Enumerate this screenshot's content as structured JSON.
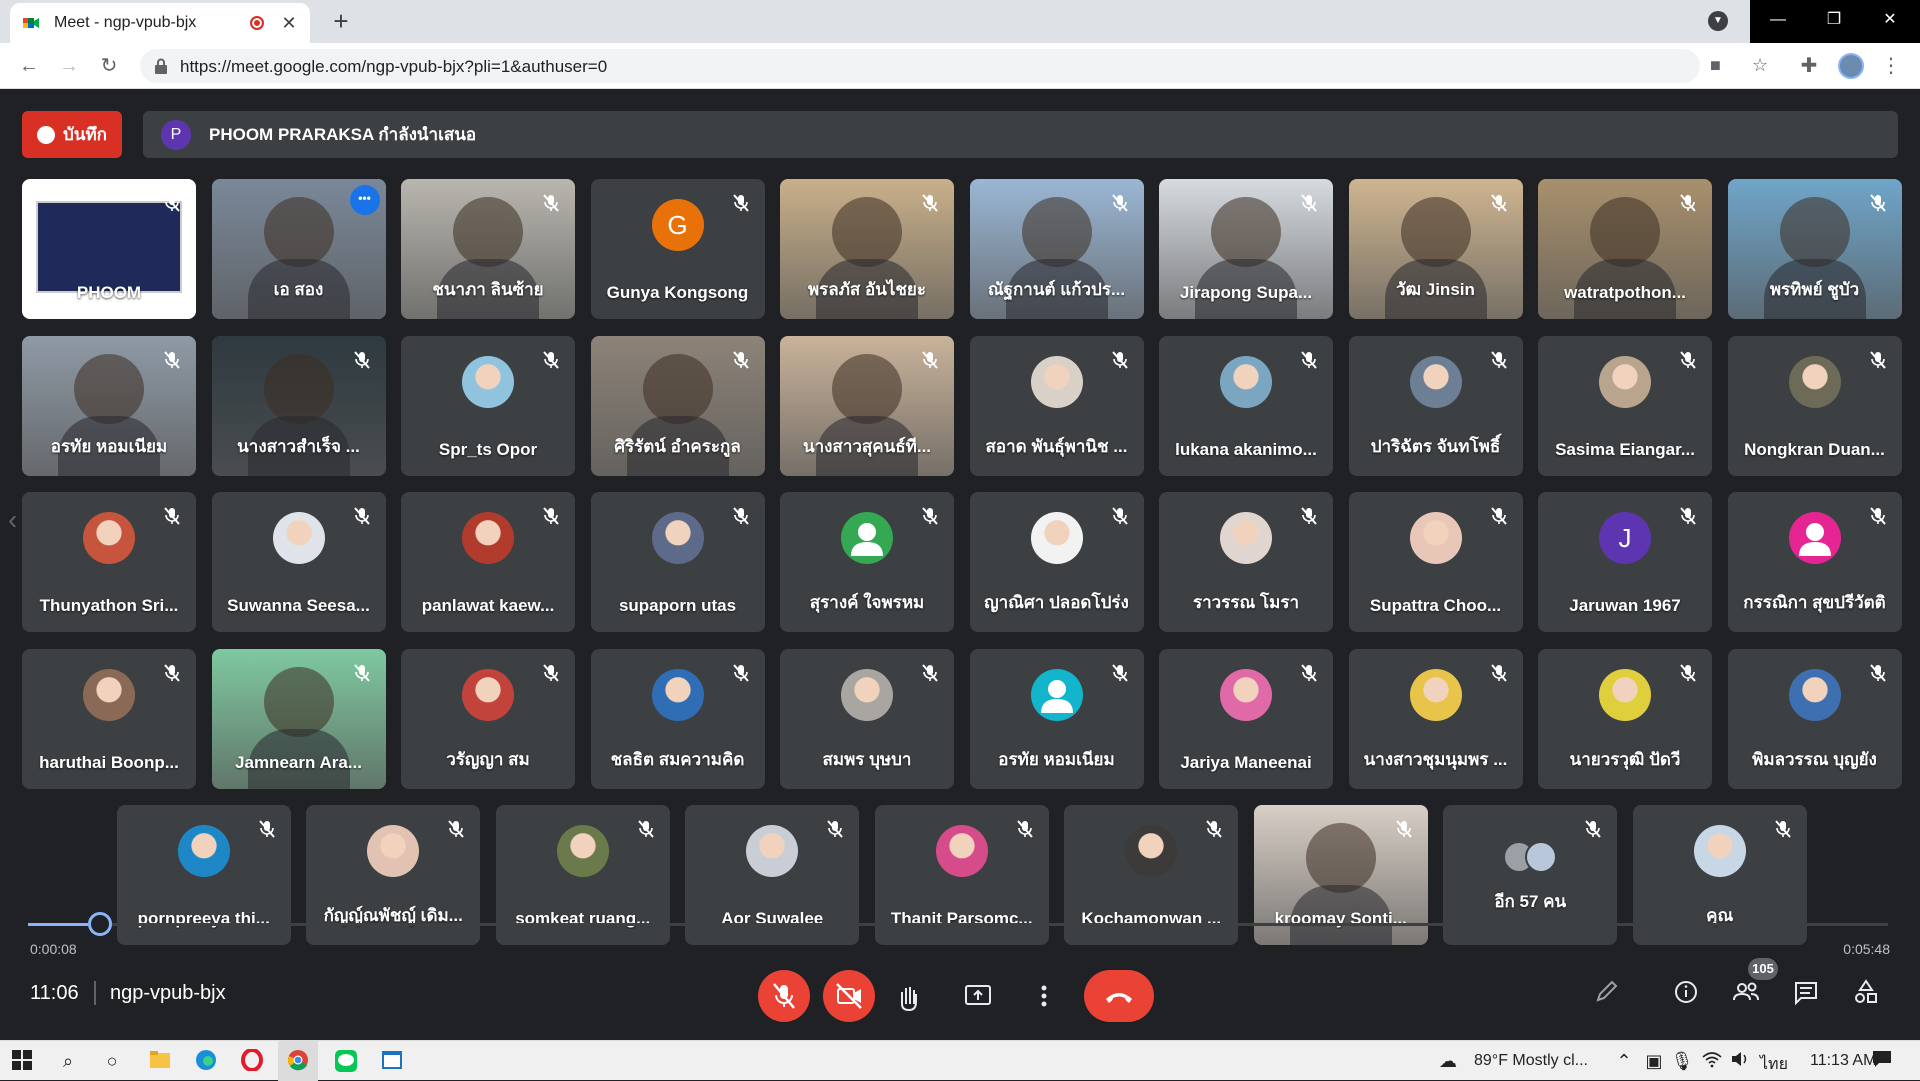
{
  "browser": {
    "tab_title": "Meet - ngp-vpub-bjx",
    "new_tab": "+",
    "url": "https://meet.google.com/ngp-vpub-bjx?pli=1&authuser=0"
  },
  "meet": {
    "record_label": "บันทึก",
    "presenter_initial": "P",
    "presenter_text": "PHOOM PRARAKSA กำลังนำเสนอ",
    "more_label": "•••",
    "time_elapsed": "0:00:08",
    "time_total": "0:05:48",
    "playback_progress": 0.016,
    "clock": "11:06",
    "meeting_code": "ngp-vpub-bjx",
    "participant_count": "105",
    "colors": {
      "record": "#d93025",
      "active_border": "#8ab4f8",
      "hangup": "#ea4335"
    }
  },
  "rows": [
    [
      {
        "name": "PHOOM",
        "kind": "screen"
      },
      {
        "name": "เอ สอง",
        "kind": "video",
        "active": true,
        "bg": "#7a8899"
      },
      {
        "name": "ชนาภา ลินซ้าย",
        "kind": "video",
        "bg": "#b8b6ae"
      },
      {
        "name": "Gunya Kongsong",
        "kind": "avatar",
        "initial": "G",
        "color": "#e8710a"
      },
      {
        "name": "พรลภัส อันไชยะ",
        "kind": "video",
        "bg": "#c9b08a"
      },
      {
        "name": "ณัฐกานต์ แก้วปร...",
        "kind": "video",
        "bg": "#9bb7d4"
      },
      {
        "name": "Jirapong Supa...",
        "kind": "video",
        "bg": "#d6dbe0"
      },
      {
        "name": "วัฒ Jinsin",
        "kind": "video",
        "bg": "#cfb590"
      },
      {
        "name": "watratpothon...",
        "kind": "video",
        "bg": "#a8906c"
      },
      {
        "name": "พรทิพย์ ชูบัว",
        "kind": "video",
        "bg": "#6fa5c9"
      }
    ],
    [
      {
        "name": "อรทัย หอมเนียม",
        "kind": "video",
        "bg": "#8f9aa6"
      },
      {
        "name": "นางสาวสำเร็จ ...",
        "kind": "video",
        "bg": "#2e3a40"
      },
      {
        "name": "Spr_ts Opor",
        "kind": "photo",
        "color": "#8fc3de"
      },
      {
        "name": "ศิริรัตน์ อำคระกูล",
        "kind": "video",
        "bg": "#8d8378"
      },
      {
        "name": "นางสาวสุคนธ์ที...",
        "kind": "video",
        "bg": "#c9b39a"
      },
      {
        "name": "สอาด พันธุ์พานิช ...",
        "kind": "photo",
        "color": "#d9d0c8"
      },
      {
        "name": "lukana akanimo...",
        "kind": "photo",
        "color": "#7aa6c2"
      },
      {
        "name": "ปาริฉัตร จันทโพธิ์",
        "kind": "photo",
        "color": "#6d7f95"
      },
      {
        "name": "Sasima Eiangar...",
        "kind": "photo",
        "color": "#b9a48e"
      },
      {
        "name": "Nongkran Duan...",
        "kind": "photo",
        "color": "#6e6a58"
      }
    ],
    [
      {
        "name": "Thunyathon Sri...",
        "kind": "photo",
        "color": "#c7543c"
      },
      {
        "name": "Suwanna Seesa...",
        "kind": "photo",
        "color": "#dfe3ea"
      },
      {
        "name": "panlawat kaew...",
        "kind": "photo",
        "color": "#b13c2d"
      },
      {
        "name": "supaporn utas",
        "kind": "photo",
        "color": "#5d6a8a"
      },
      {
        "name": "สุรางค์ ใจพรหม",
        "kind": "default",
        "color": "#34a853"
      },
      {
        "name": "ญาณิศา ปลอดโปร่ง",
        "kind": "photo",
        "color": "#f2f2f2"
      },
      {
        "name": "ราวรรณ โมรา",
        "kind": "photo",
        "color": "#e0d6cf"
      },
      {
        "name": "Supattra Choo...",
        "kind": "photo",
        "color": "#e9c7b8"
      },
      {
        "name": "Jaruwan 1967",
        "kind": "avatar",
        "initial": "J",
        "color": "#5e35b1"
      },
      {
        "name": "กรรณิกา สุขปรีวัตติ",
        "kind": "default",
        "color": "#e52592"
      }
    ],
    [
      {
        "name": "haruthai Boonp...",
        "kind": "photo",
        "color": "#8a6a56"
      },
      {
        "name": "Jamnearn Ara...",
        "kind": "video",
        "bg": "#7fc9a0"
      },
      {
        "name": "วรัญญา สม",
        "kind": "photo",
        "color": "#c2433c"
      },
      {
        "name": "ชลธิต สมความคิด",
        "kind": "photo",
        "color": "#2f6db5"
      },
      {
        "name": "สมพร บุษบา",
        "kind": "photo",
        "color": "#a9a6a2"
      },
      {
        "name": "อรทัย หอมเนียม",
        "kind": "default",
        "color": "#12b5cb"
      },
      {
        "name": "Jariya Maneenai",
        "kind": "photo",
        "color": "#e06aa8"
      },
      {
        "name": "นางสาวชุมนุมพร ...",
        "kind": "photo",
        "color": "#e8c44a"
      },
      {
        "name": "นายวรวุฒิ ปัดวี",
        "kind": "photo",
        "color": "#e0cf3c"
      },
      {
        "name": "พิมลวรรณ บุญยัง",
        "kind": "photo",
        "color": "#3e6fb0"
      }
    ],
    [
      {
        "name": "pornpreeya thi...",
        "kind": "photo",
        "color": "#1e88c7"
      },
      {
        "name": "กัญญ์ณพัชญ์ เดิม...",
        "kind": "photo",
        "color": "#e2c3b3"
      },
      {
        "name": "somkeat ruang...",
        "kind": "photo",
        "color": "#6b7a4a"
      },
      {
        "name": "Aor Suwalee",
        "kind": "photo",
        "color": "#c9ced6"
      },
      {
        "name": "Thanit Parsomc...",
        "kind": "photo",
        "color": "#d64c8a"
      },
      {
        "name": "Kochamonwan ...",
        "kind": "photo",
        "color": "#3d3a3a"
      },
      {
        "name": "kroomay Sonti...",
        "kind": "video",
        "bg": "#d8cfc6"
      },
      {
        "name": "อีก 57 คน",
        "kind": "others"
      },
      {
        "name": "คุณ",
        "kind": "photo",
        "color": "#c8d7e6"
      }
    ]
  ],
  "taskbar": {
    "weather": "89°F  Mostly cl...",
    "lang": "ไทย",
    "time": "11:13 AM"
  }
}
